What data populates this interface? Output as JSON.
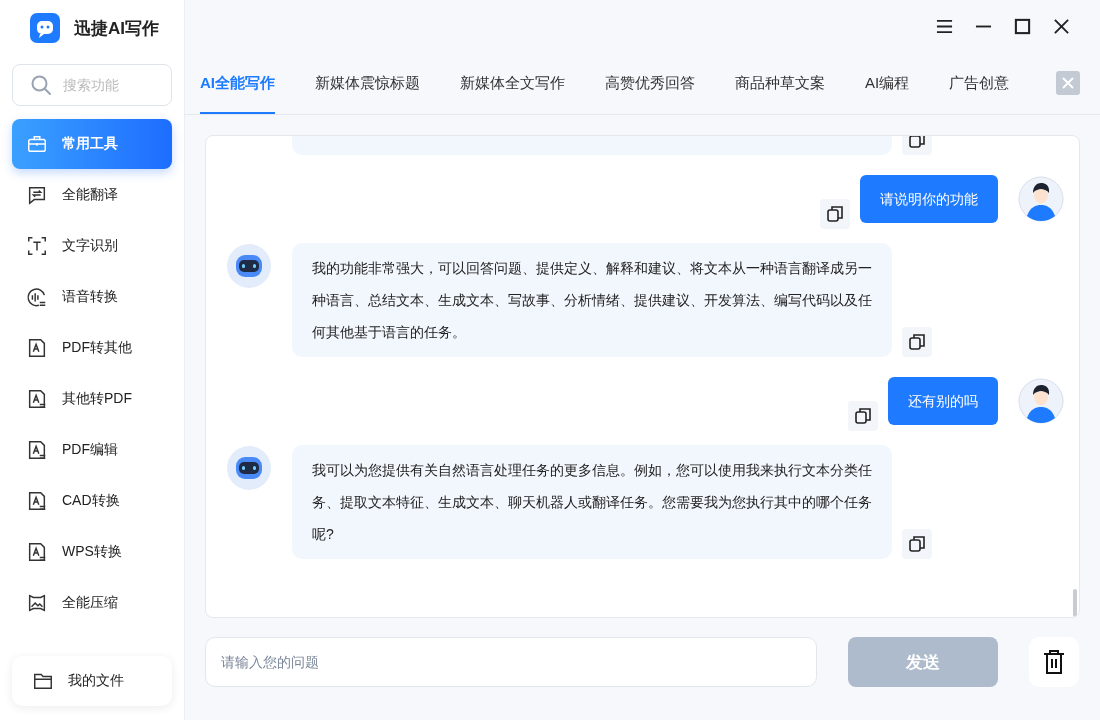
{
  "app": {
    "title": "迅捷AI写作"
  },
  "sidebar": {
    "search": {
      "placeholder": "搜索功能"
    },
    "items": [
      {
        "label": "常用工具",
        "kind": "toolbox",
        "selected": true
      },
      {
        "label": "全能翻译",
        "kind": "translate",
        "selected": false
      },
      {
        "label": "文字识别",
        "kind": "ocr",
        "selected": false
      },
      {
        "label": "语音转换",
        "kind": "voice",
        "selected": false
      },
      {
        "label": "PDF转其他",
        "kind": "doc",
        "selected": false
      },
      {
        "label": "其他转PDF",
        "kind": "docs",
        "selected": false
      },
      {
        "label": "PDF编辑",
        "kind": "docgear",
        "selected": false
      },
      {
        "label": "CAD转换",
        "kind": "docswap",
        "selected": false
      },
      {
        "label": "WPS转换",
        "kind": "wps",
        "selected": false
      },
      {
        "label": "全能压缩",
        "kind": "image",
        "selected": false
      }
    ],
    "footer": {
      "label": "我的文件"
    }
  },
  "tabs": [
    {
      "label": "AI全能写作",
      "selected": true
    },
    {
      "label": "新媒体震惊标题",
      "selected": false
    },
    {
      "label": "新媒体全文写作",
      "selected": false
    },
    {
      "label": "高赞优秀回答",
      "selected": false
    },
    {
      "label": "商品种草文案",
      "selected": false
    },
    {
      "label": "AI编程",
      "selected": false
    },
    {
      "label": "广告创意",
      "selected": false
    }
  ],
  "messages": [
    {
      "kind": "user",
      "text": "请说明你的功能"
    },
    {
      "kind": "bot",
      "text": "我的功能非常强大，可以回答问题、提供定义、解释和建议、将文本从一种语言翻译成另一种语言、总结文本、生成文本、写故事、分析情绪、提供建议、开发算法、编写代码以及任何其他基于语言的任务。"
    },
    {
      "kind": "user",
      "text": "还有别的吗"
    },
    {
      "kind": "bot",
      "text": "我可以为您提供有关自然语言处理任务的更多信息。例如，您可以使用我来执行文本分类任务、提取文本特征、生成文本、聊天机器人或翻译任务。您需要我为您执行其中的哪个任务呢?"
    }
  ],
  "input": {
    "placeholder": "请输入您的问题"
  },
  "send_button": {
    "label": "发送",
    "disabled": true
  }
}
